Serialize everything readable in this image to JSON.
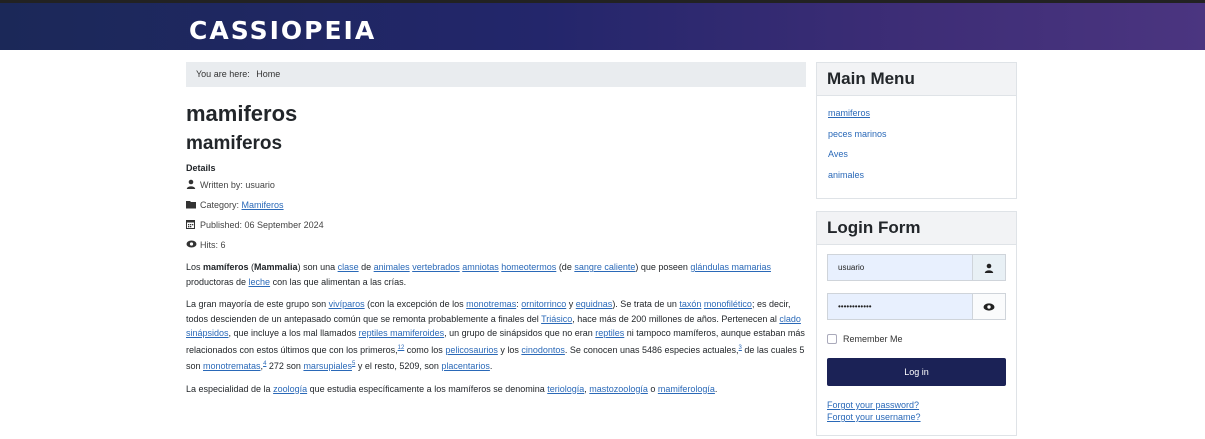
{
  "site": {
    "brand": "CASSIOPEIA"
  },
  "breadcrumb": {
    "prefix": "You are here:",
    "home": "Home"
  },
  "page": {
    "title": "mamiferos"
  },
  "article": {
    "title": "mamiferos",
    "details_label": "Details",
    "written_by": "Written by: usuario",
    "category_label": "Category:",
    "category_link": "Mamiferos",
    "published": "Published: 06 September 2024",
    "hits": "Hits: 6",
    "p1": {
      "t1": "Los ",
      "b1": "mamíferos",
      "t2": " (",
      "b2": "Mammalia",
      "t3": ") son una ",
      "l1": "clase",
      "t4": " de ",
      "l2": "animales",
      "t5": " ",
      "l3": "vertebrados",
      "t6": " ",
      "l4": "amniotas",
      "t7": " ",
      "l5": "homeotermos",
      "t8": " (de ",
      "l6": "sangre caliente",
      "t9": ") que poseen ",
      "l7": "glándulas mamarias",
      "t10": " productoras de ",
      "l8": "leche",
      "t11": " con las que alimentan a las crías."
    },
    "p2": {
      "t1": "La gran mayoría de este grupo son ",
      "l1": "vivíparos",
      "t2": " (con la excepción de los ",
      "l2": "monotremas",
      "t3": ": ",
      "l3": "ornitorrinco",
      "t4": " y ",
      "l4": "equidnas",
      "t5": "). Se trata de un ",
      "l5": "taxón",
      "t6": " ",
      "l6": "monofilético",
      "t7": "; es decir, todos descienden de un antepasado común que se remonta probablemente a finales del ",
      "l7": "Triásico",
      "t8": ", hace más de 200 millones de años. Pertenecen al ",
      "l8": "clado",
      "t9": " ",
      "l9": "sinápsidos",
      "t10": ", que incluye a los mal llamados ",
      "l10": "reptiles mamiferoides",
      "t11": ", un grupo de sinápsidos que no eran ",
      "l11": "reptiles",
      "t12": " ni tampoco mamíferos, aunque estaban más relacionados con estos últimos que con los primeros,",
      "s1": "12",
      "t13": " como los ",
      "l12": "pelicosaurios",
      "t14": " y los ",
      "l13": "cinodontos",
      "t15": ". Se conocen unas 5486 especies actuales,",
      "s2": "3",
      "t16": " de las cuales 5 son ",
      "l14": "monotrematas",
      "t17": ",",
      "s3": "4",
      "t18": " 272 son ",
      "l15": "marsupiales",
      "s4": "5",
      "t19": " y el resto, 5209, son ",
      "l16": "placentarios",
      "t20": "."
    },
    "p3": {
      "t1": "La especialidad de la ",
      "l1": "zoología",
      "t2": " que estudia específicamente a los mamíferos se denomina ",
      "l2": "teriología",
      "t3": ", ",
      "l3": "mastozoología",
      "t4": " o ",
      "l4": "mamiferología",
      "t5": "."
    }
  },
  "main_menu": {
    "title": "Main Menu",
    "items": [
      "mamiferos",
      "peces marinos",
      "Aves",
      "animales"
    ]
  },
  "login": {
    "title": "Login Form",
    "username_value": "usuario",
    "password_value": "••••••••••••",
    "remember_label": "Remember Me",
    "button_label": "Log in",
    "forgot_password": "Forgot your password?",
    "forgot_username": "Forgot your username?"
  },
  "icons": {
    "user": "user-icon",
    "folder": "folder-icon",
    "calendar": "calendar-icon",
    "eye": "eye-icon"
  },
  "colors": {
    "brand_start": "#1b2858",
    "brand_end": "#4b3580",
    "link": "#2a69b8",
    "button": "#1b2256"
  }
}
